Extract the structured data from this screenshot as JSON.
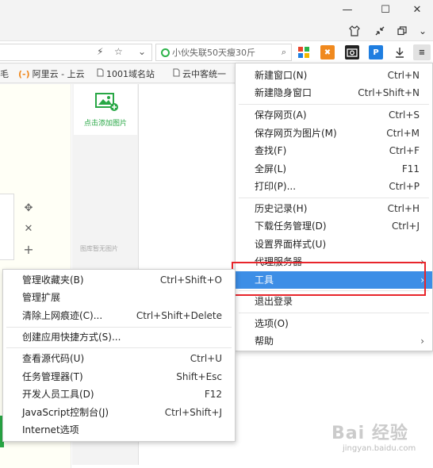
{
  "window": {
    "min_icon": "minimize-icon",
    "max_icon": "maximize-icon",
    "close_icon": "close-icon"
  },
  "toolbar": {
    "search_text": "小伙失联50天瘦30斤",
    "ext_colors": [
      "#e8452c",
      "#f0891e",
      "#222222",
      "#1f7ee0",
      "#333333"
    ]
  },
  "bookmarks": {
    "items": [
      {
        "label": "阿里云 - 上云",
        "icon": "(-)"
      },
      {
        "label": "1001域名站",
        "icon": "doc-icon"
      },
      {
        "label": "云中客统一",
        "icon": "doc-icon"
      }
    ],
    "partial_left": "毛"
  },
  "page": {
    "add_image_label": "点击添加图片",
    "empty_gallery": "图库暂无图片"
  },
  "main_menu": {
    "items": [
      {
        "label": "新建窗口(N)",
        "shortcut": "Ctrl+N"
      },
      {
        "label": "新建隐身窗口",
        "shortcut": "Ctrl+Shift+N"
      },
      {
        "label": "保存网页(A)",
        "shortcut": "Ctrl+S"
      },
      {
        "label": "保存网页为图片(M)",
        "shortcut": "Ctrl+M"
      },
      {
        "label": "查找(F)",
        "shortcut": "Ctrl+F"
      },
      {
        "label": "全屏(L)",
        "shortcut": "F11"
      },
      {
        "label": "打印(P)...",
        "shortcut": "Ctrl+P"
      },
      {
        "label": "历史记录(H)",
        "shortcut": "Ctrl+H"
      },
      {
        "label": "下载任务管理(D)",
        "shortcut": "Ctrl+J"
      },
      {
        "label": "设置界面样式(U)",
        "shortcut": ""
      },
      {
        "label": "代理服务器",
        "shortcut": ""
      },
      {
        "label": "工具",
        "shortcut": ""
      },
      {
        "label": "退出登录",
        "shortcut": ""
      },
      {
        "label": "选项(O)",
        "shortcut": ""
      },
      {
        "label": "帮助",
        "shortcut": ""
      }
    ]
  },
  "tools_menu": {
    "items": [
      {
        "label": "管理收藏夹(B)",
        "shortcut": "Ctrl+Shift+O"
      },
      {
        "label": "管理扩展",
        "shortcut": ""
      },
      {
        "label": "清除上网痕迹(C)...",
        "shortcut": "Ctrl+Shift+Delete"
      },
      {
        "label": "创建应用快捷方式(S)...",
        "shortcut": ""
      },
      {
        "label": "查看源代码(U)",
        "shortcut": "Ctrl+U"
      },
      {
        "label": "任务管理器(T)",
        "shortcut": "Shift+Esc"
      },
      {
        "label": "开发人员工具(D)",
        "shortcut": "F12"
      },
      {
        "label": "JavaScript控制台(J)",
        "shortcut": "Ctrl+Shift+J"
      },
      {
        "label": "Internet选项",
        "shortcut": ""
      }
    ]
  },
  "watermark": {
    "text": "Bai 经验",
    "sub": "jingyan.baidu.com"
  },
  "colors": {
    "menu_highlight": "#3d8ee6",
    "red_box": "#e8252b",
    "green": "#28a745"
  }
}
